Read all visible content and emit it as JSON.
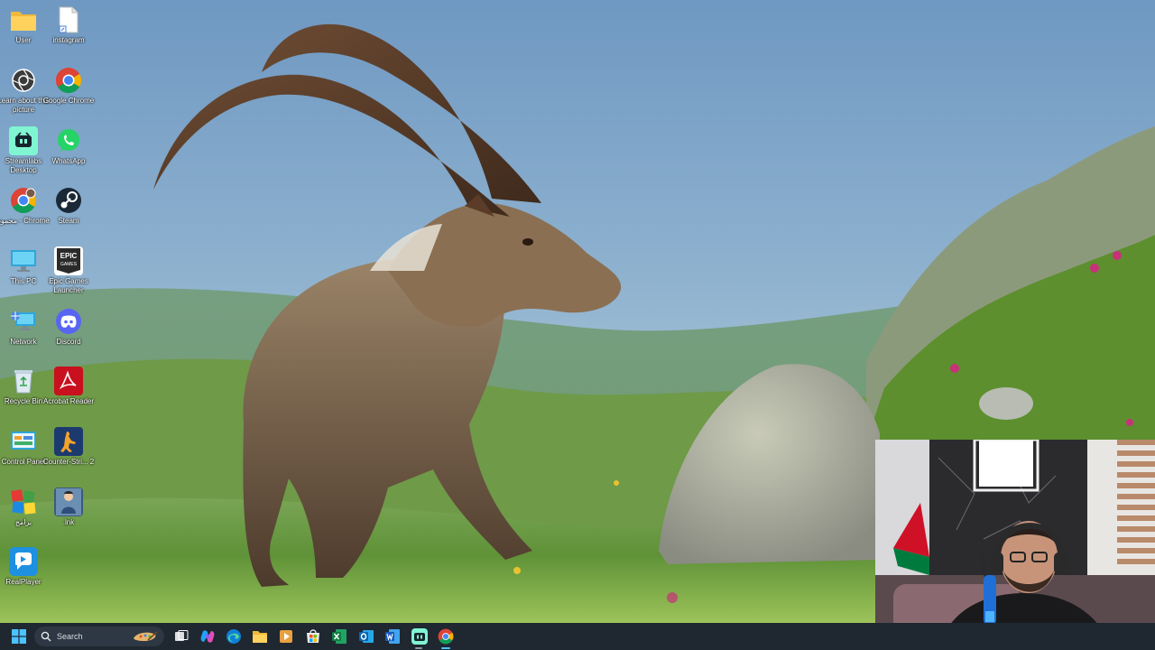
{
  "desktop": {
    "icons": [
      {
        "label": "User",
        "icon": "folder-icon"
      },
      {
        "label": "instagram",
        "icon": "file-shortcut-icon"
      },
      {
        "label": "Learn about this picture",
        "icon": "camera-icon"
      },
      {
        "label": "Google Chrome",
        "icon": "chrome-icon"
      },
      {
        "label": "Streamlabs Desktop",
        "icon": "streamlabs-icon"
      },
      {
        "label": "WhatsApp",
        "icon": "whatsapp-icon"
      },
      {
        "label": "محمود - Chrome",
        "icon": "chrome-profile-icon"
      },
      {
        "label": "Steam",
        "icon": "steam-icon"
      },
      {
        "label": "This PC",
        "icon": "monitor-icon"
      },
      {
        "label": "Epic Games Launcher",
        "icon": "epic-games-icon"
      },
      {
        "label": "Network",
        "icon": "network-icon"
      },
      {
        "label": "Discord",
        "icon": "discord-icon"
      },
      {
        "label": "Recycle Bin",
        "icon": "recycle-bin-icon"
      },
      {
        "label": "Acrobat Reader",
        "icon": "acrobat-icon"
      },
      {
        "label": "Control Panel",
        "icon": "control-panel-icon"
      },
      {
        "label": "Counter-Stri... 2",
        "icon": "counter-strike-icon"
      },
      {
        "label": "برامج",
        "icon": "programs-folder-icon"
      },
      {
        "label": ".lnk",
        "icon": "lnk-shortcut-icon"
      },
      {
        "label": "RealPlayer",
        "icon": "realplayer-icon"
      }
    ]
  },
  "taskbar": {
    "search_label": "Search",
    "pinned": [
      "start-icon",
      "search-icon",
      "task-view-icon",
      "copilot-icon",
      "edge-icon",
      "file-explorer-icon",
      "media-player-icon",
      "store-icon",
      "excel-icon",
      "outlook-icon",
      "word-icon",
      "streamlabs-icon",
      "chrome-icon"
    ]
  },
  "colors": {
    "taskbar_bg": "#1f2731",
    "accent": "#4cc2ff",
    "icon_label": "#ffffff"
  }
}
